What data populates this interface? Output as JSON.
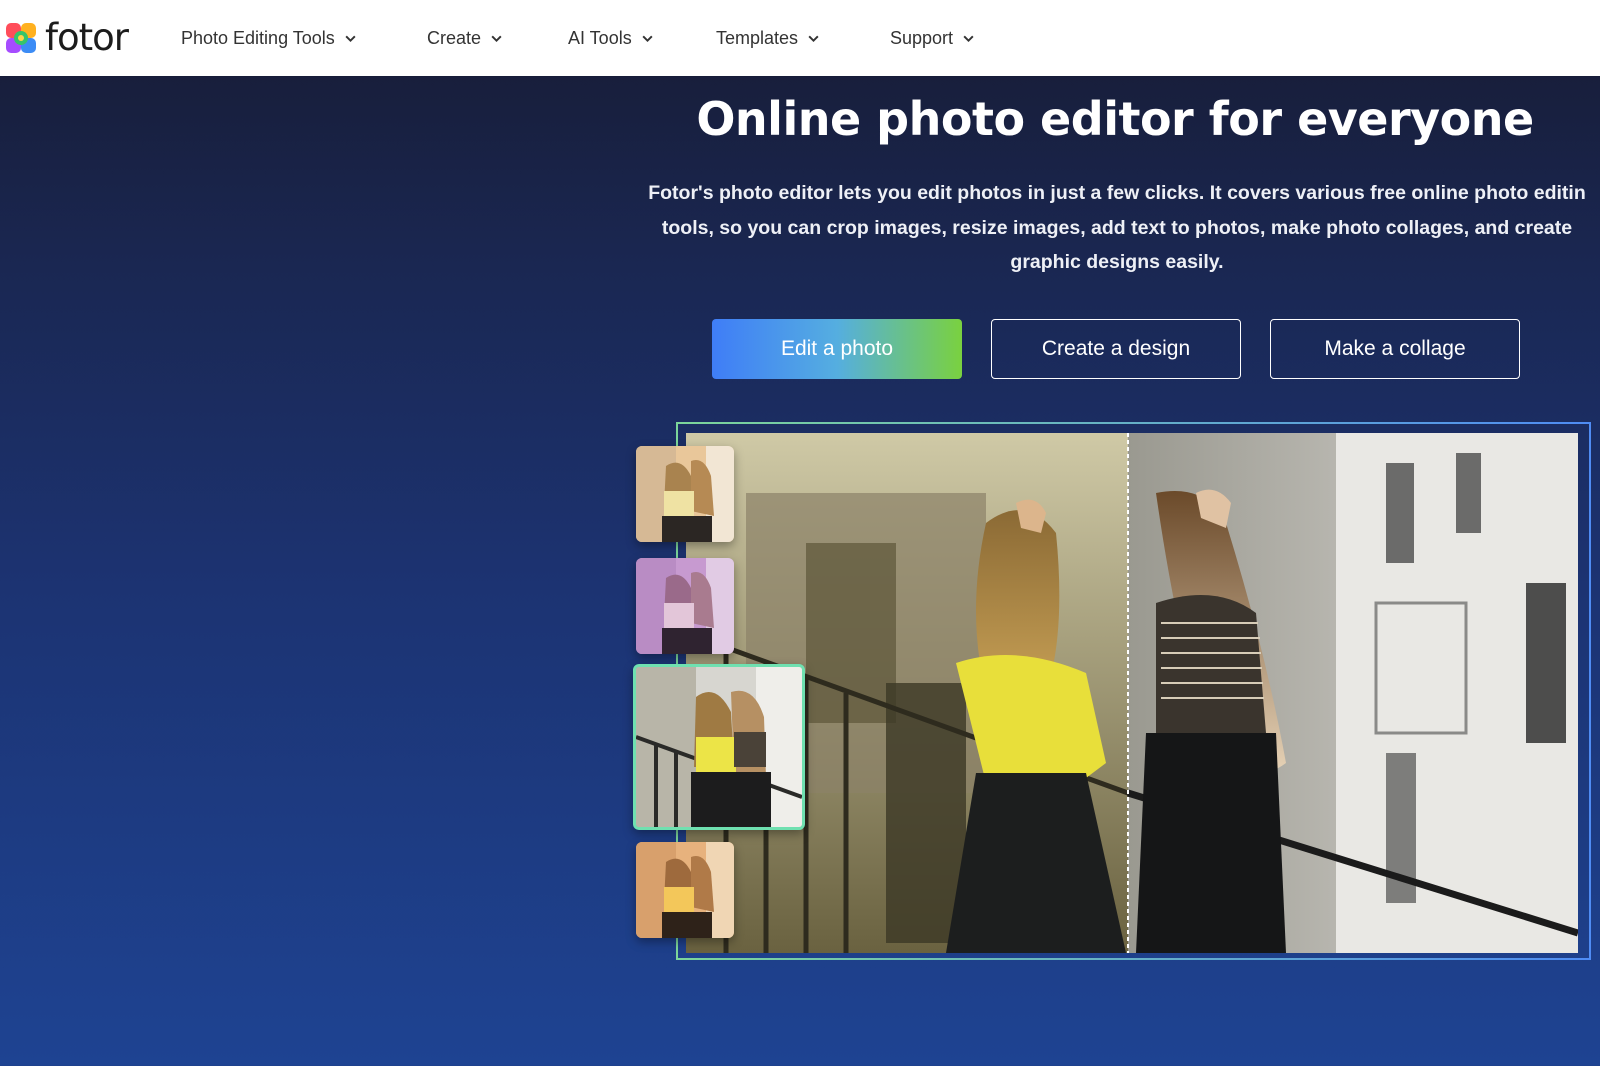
{
  "header": {
    "logo_text": "fotor",
    "nav": [
      {
        "label": "Photo Editing Tools"
      },
      {
        "label": "Create"
      },
      {
        "label": "AI Tools"
      },
      {
        "label": "Templates"
      },
      {
        "label": "Support"
      }
    ]
  },
  "hero": {
    "title": "Online photo editor for everyone",
    "description_lines": [
      "Fotor's photo editor lets you edit photos in just a few clicks. It covers various free online photo editin",
      "tools, so you can crop images, resize images, add text to photos, make photo collages, and create",
      "graphic designs easily."
    ],
    "buttons": {
      "edit": "Edit a photo",
      "design": "Create a design",
      "collage": "Make a collage"
    }
  },
  "showcase": {
    "thumbnails": [
      "warm-filter",
      "purple-filter",
      "original",
      "vintage-filter"
    ],
    "selected_thumbnail": "original",
    "compare_divider": "before-after"
  },
  "colors": {
    "accent_blue": "#3f7df7",
    "accent_green": "#7ad13f",
    "bg_dark": "#171b33",
    "bg_blue": "#1e4392"
  }
}
